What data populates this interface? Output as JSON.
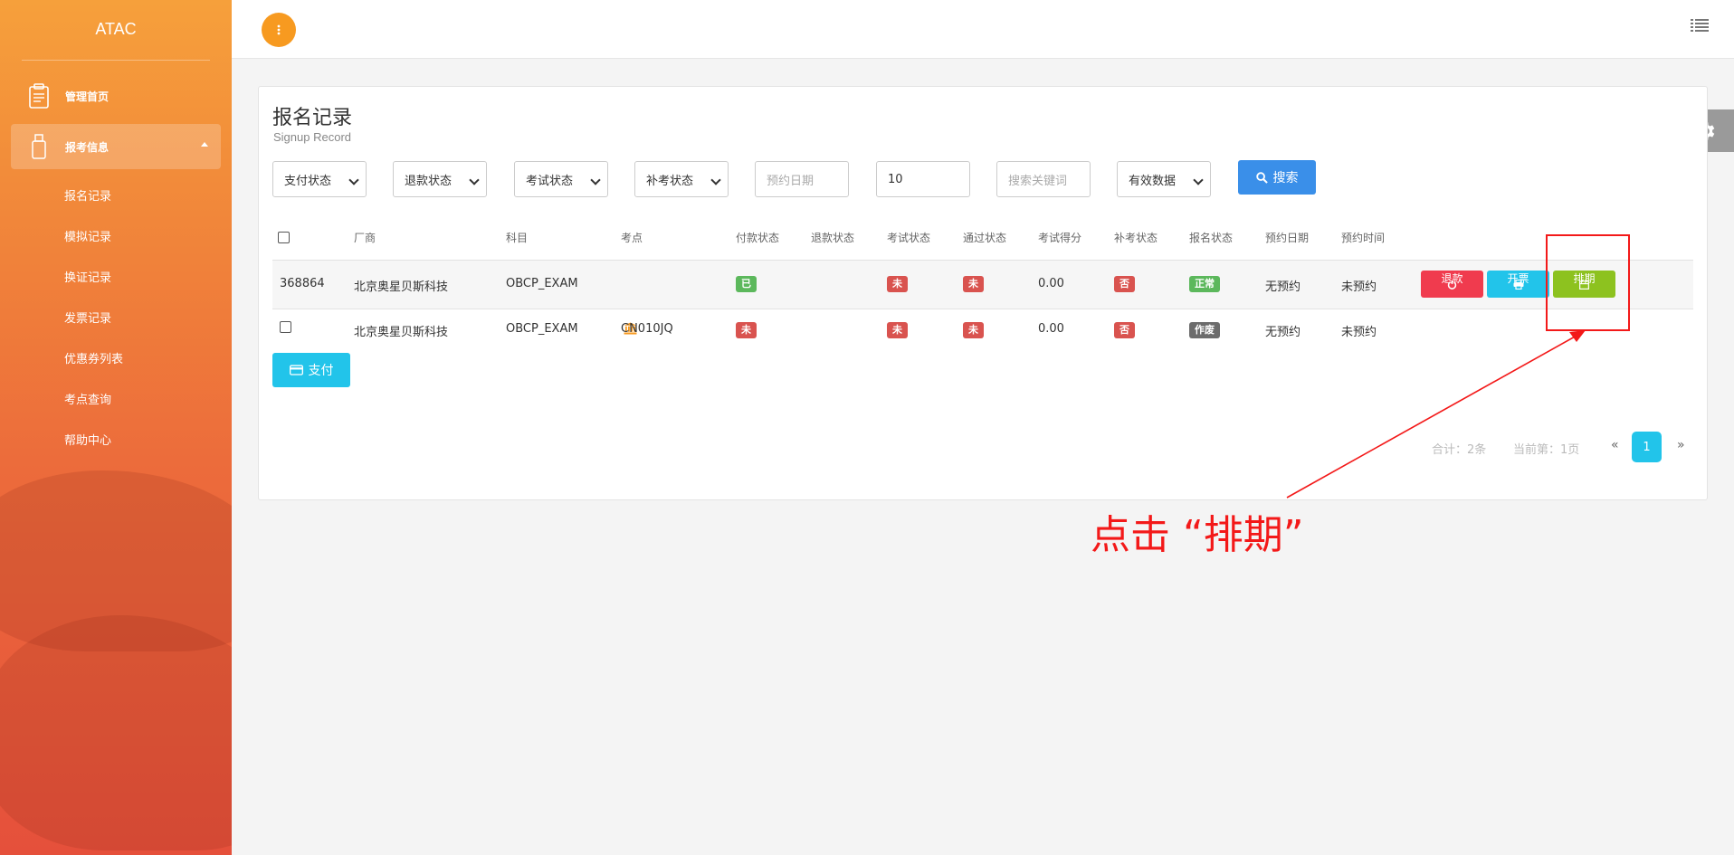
{
  "sidebar": {
    "brand": "ATAC",
    "items": [
      {
        "label": "管理首页"
      },
      {
        "label": "报考信息"
      }
    ],
    "sub_items": [
      {
        "label": "报名记录"
      },
      {
        "label": "模拟记录"
      },
      {
        "label": "换证记录"
      },
      {
        "label": "发票记录"
      },
      {
        "label": "优惠券列表"
      },
      {
        "label": "考点查询"
      },
      {
        "label": "帮助中心"
      }
    ]
  },
  "page": {
    "title": "报名记录",
    "subtitle": "Signup Record"
  },
  "filters": {
    "pay_status": "支付状态",
    "refund_status": "退款状态",
    "exam_status": "考试状态",
    "makeup_status": "补考状态",
    "date_placeholder": "预约日期",
    "page_size": "10",
    "keyword_placeholder": "搜索关键词",
    "data_filter": "有效数据",
    "search_label": "搜索"
  },
  "table": {
    "headers": [
      "厂商",
      "科目",
      "考点",
      "付款状态",
      "退款状态",
      "考试状态",
      "通过状态",
      "考试得分",
      "补考状态",
      "报名状态",
      "预约日期",
      "预约时间"
    ],
    "rows": [
      {
        "id": "368864",
        "vendor": "北京奥星贝斯科技",
        "subject": "OBCP_EXAM",
        "site": "",
        "pay": "已",
        "exam": "未",
        "pass": "未",
        "score": "0.00",
        "makeup": "否",
        "signup": "正常",
        "date": "无预约",
        "time": "未预约",
        "actions": {
          "refund": "退款",
          "invoice": "开票",
          "schedule": "排期"
        }
      },
      {
        "id": "",
        "vendor": "北京奥星贝斯科技",
        "subject": "OBCP_EXAM",
        "site": "CN010JQ",
        "pay": "未",
        "exam": "未",
        "pass": "未",
        "score": "0.00",
        "makeup": "否",
        "signup": "作废",
        "date": "无预约",
        "time": "未预约"
      }
    ]
  },
  "pay_button": "支付",
  "pagination": {
    "total": "合计：2条",
    "current": "当前第：1页",
    "prev": "«",
    "page": "1",
    "next": "»"
  },
  "annotation": {
    "text": "点击 “排期”",
    "color": "#f31919"
  },
  "colors": {
    "accent_orange": "#f79a20",
    "search_blue": "#3a8fe9",
    "cyan": "#22c4ea",
    "refund_red": "#f03b4e",
    "schedule_green": "#8dc21f"
  }
}
